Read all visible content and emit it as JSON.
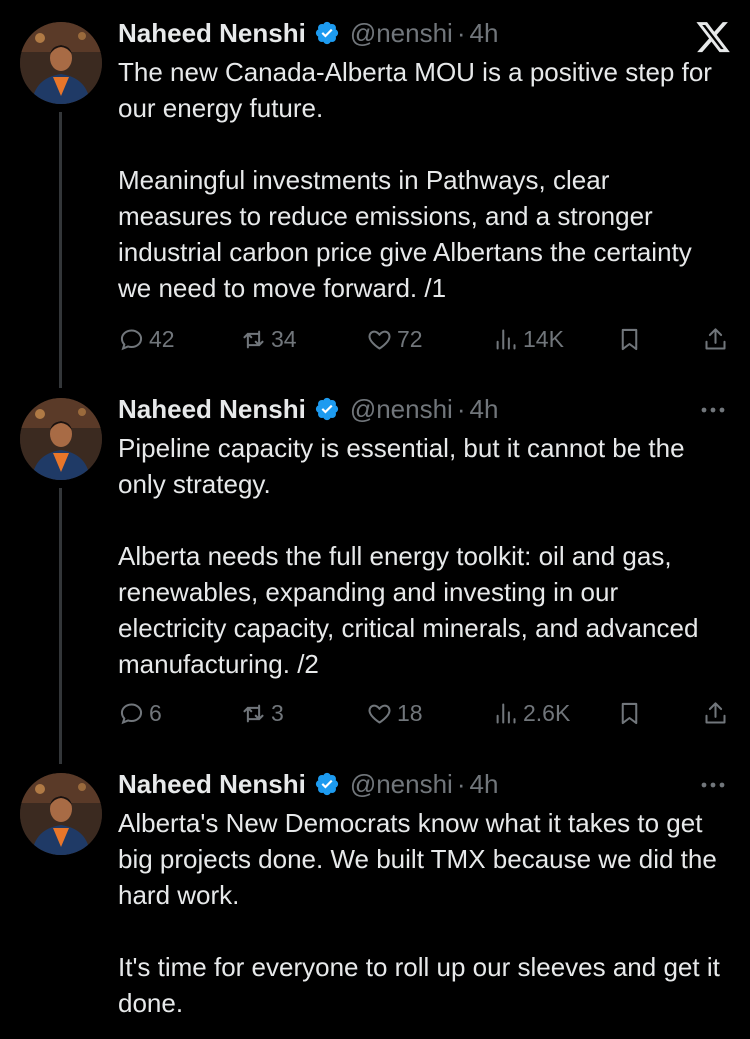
{
  "tweets": [
    {
      "author": "Naheed Nenshi",
      "handle": "@nenshi",
      "separator": "·",
      "time": "4h",
      "paragraphs": [
        "The new Canada-Alberta MOU is a positive step for our energy future.",
        "Meaningful investments in Pathways, clear measures to reduce emissions, and a stronger industrial carbon price give Albertans the certainty we need to move forward. /1"
      ],
      "replies": "42",
      "reposts": "34",
      "likes": "72",
      "views": "14K"
    },
    {
      "author": "Naheed Nenshi",
      "handle": "@nenshi",
      "separator": "·",
      "time": "4h",
      "paragraphs": [
        "Pipeline capacity is essential, but it cannot be the only strategy.",
        "Alberta needs the full energy toolkit: oil and gas, renewables, expanding and investing in our electricity capacity, critical minerals, and advanced manufacturing. /2"
      ],
      "replies": "6",
      "reposts": "3",
      "likes": "18",
      "views": "2.6K"
    },
    {
      "author": "Naheed Nenshi",
      "handle": "@nenshi",
      "separator": "·",
      "time": "4h",
      "paragraphs": [
        "Alberta's New Democrats know what it takes to get big projects done. We built TMX because we did the hard work.",
        "It's time for everyone to roll up our sleeves and get it done."
      ]
    }
  ],
  "colors": {
    "background": "#000000",
    "text": "#e7e9ea",
    "muted": "#71767b",
    "verified": "#1d9bf0"
  },
  "icons": [
    "x-logo-icon",
    "verified-badge-icon",
    "reply-icon",
    "repost-icon",
    "like-icon",
    "views-icon",
    "bookmark-icon",
    "share-icon",
    "more-icon"
  ]
}
